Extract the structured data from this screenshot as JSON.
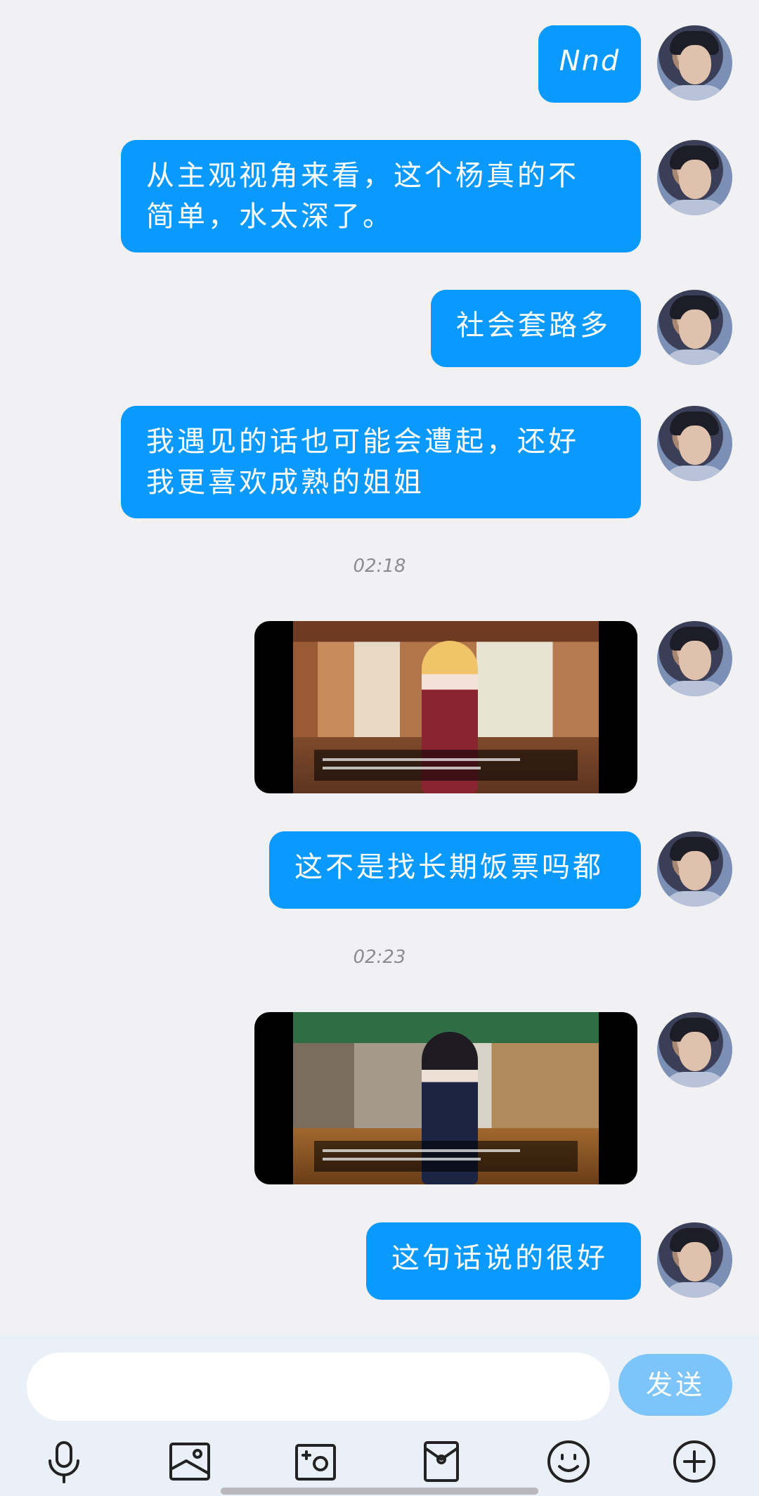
{
  "messages": [
    {
      "type": "text",
      "text": "Nnd"
    },
    {
      "type": "text",
      "text": "从主观视角来看，这个杨真的不\n简单，水太深了。"
    },
    {
      "type": "text",
      "text": "社会套路多"
    },
    {
      "type": "text",
      "text": "我遇见的话也可能会遭起，还好\n我更喜欢成熟的姐姐"
    },
    {
      "type": "time",
      "text": "02:18"
    },
    {
      "type": "image"
    },
    {
      "type": "text",
      "text": "这不是找长期饭票吗都"
    },
    {
      "type": "time",
      "text": "02:23"
    },
    {
      "type": "image"
    },
    {
      "type": "text",
      "text": "这句话说的很好"
    }
  ],
  "input": {
    "placeholder": "",
    "send_label": "发送"
  },
  "toolbar": {
    "icons": [
      "microphone-icon",
      "image-icon",
      "camera-icon",
      "red-packet-icon",
      "emoji-icon",
      "plus-icon"
    ]
  },
  "colors": {
    "bubble": "#0a99ff",
    "send_button": "#7cc4f9",
    "background": "#f1f1f3"
  }
}
